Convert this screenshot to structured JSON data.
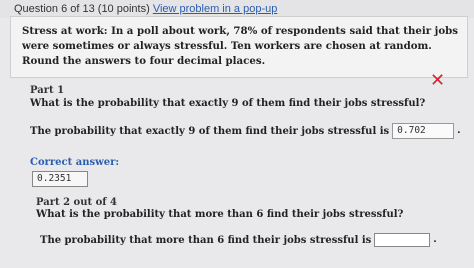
{
  "header": {
    "question_label": "Question 6 of 13 (10 points)",
    "popup_link": "View problem in a pop-up"
  },
  "problem": {
    "text": "Stress at work: In a poll about work, 78% of respondents said that their jobs were sometimes or always stressful. Ten workers are chosen at random. Round the answers to four decimal places."
  },
  "part1": {
    "label": "Part 1",
    "question": "What is the probability that exactly 9 of them find their jobs stressful?",
    "answer_prompt": "The probability that exactly 9 of them find their jobs stressful is",
    "answer_value": "0.702",
    "status_icon": "x-mark-icon",
    "correct_label": "Correct answer:",
    "correct_value": "0.2351"
  },
  "part2": {
    "label": "Part 2 out of 4",
    "question": "What is the probability that more than 6 find their jobs stressful?",
    "answer_prompt": "The probability that more than 6 find their jobs stressful is",
    "answer_value": ""
  },
  "colors": {
    "link": "#2a5db0",
    "incorrect": "#d9262e"
  }
}
